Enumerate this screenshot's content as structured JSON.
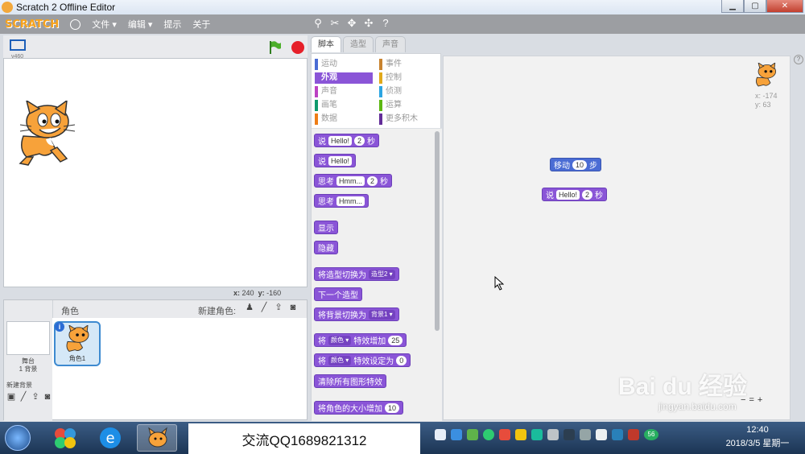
{
  "window": {
    "title": "Scratch 2 Offline Editor",
    "minimize": "▁",
    "maximize": "▢",
    "close": "✕"
  },
  "menubar": {
    "logo": "SCRATCH",
    "items": [
      "文件 ▾",
      "编辑 ▾",
      "提示",
      "关于"
    ],
    "tools": [
      "duplicate-icon",
      "delete-icon",
      "grow-icon",
      "shrink-icon",
      "help-icon"
    ]
  },
  "stage": {
    "version": "v460",
    "coord_x_label": "x:",
    "coord_x": "240",
    "coord_y_label": "y:",
    "coord_y": "-160"
  },
  "sprites": {
    "title": "角色",
    "new_sprite_label": "新建角色:",
    "stage_name": "舞台",
    "stage_backdrops": "1 背景",
    "new_backdrop": "新建背景",
    "sprite_name": "角色1",
    "info_badge": "i"
  },
  "tabs": [
    "脚本",
    "造型",
    "声音"
  ],
  "categories": [
    {
      "label": "运动",
      "color": "#4a6cd4"
    },
    {
      "label": "事件",
      "color": "#c88330"
    },
    {
      "label": "外观",
      "color": "#8a55d7"
    },
    {
      "label": "控制",
      "color": "#e1a91a"
    },
    {
      "label": "声音",
      "color": "#bb42c3"
    },
    {
      "label": "侦测",
      "color": "#2ca5e2"
    },
    {
      "label": "画笔",
      "color": "#0e9a6c"
    },
    {
      "label": "运算",
      "color": "#5cb712"
    },
    {
      "label": "数据",
      "color": "#ee7d16"
    },
    {
      "label": "更多积木",
      "color": "#632d99"
    }
  ],
  "palette_blocks": {
    "say_secs": {
      "say": "说",
      "text": "Hello!",
      "num": "2",
      "secs": "秒"
    },
    "say": {
      "say": "说",
      "text": "Hello!"
    },
    "think_secs": {
      "think": "思考",
      "text": "Hmm...",
      "num": "2",
      "secs": "秒"
    },
    "think": {
      "think": "思考",
      "text": "Hmm..."
    },
    "show": "显示",
    "hide": "隐藏",
    "switch_costume": {
      "label": "将造型切换为",
      "value": "造型2 ▾"
    },
    "next_costume": "下一个造型",
    "switch_backdrop": {
      "label": "将背景切换为",
      "value": "背景1 ▾"
    },
    "change_effect": {
      "prefix": "将",
      "effect": "颜色 ▾",
      "label": "特效增加",
      "num": "25"
    },
    "set_effect": {
      "prefix": "将",
      "effect": "颜色 ▾",
      "label": "特效设定为",
      "num": "0"
    },
    "clear_effects": "清除所有图形特效",
    "change_size": {
      "label": "将角色的大小增加",
      "num": "10"
    }
  },
  "script_blocks": {
    "move": {
      "label": "移动",
      "num": "10",
      "unit": "步"
    },
    "say_secs": {
      "say": "说",
      "text": "Hello!",
      "num": "2",
      "secs": "秒"
    }
  },
  "sprite_info": {
    "x_label": "x:",
    "x": "-174",
    "y_label": "y:",
    "y": "63"
  },
  "zoom": [
    "−",
    "=",
    "+"
  ],
  "watermark": {
    "brand": "Bai du 经验",
    "url": "jingyan.baidu.com"
  },
  "taskbar": {
    "banner": "交流QQ1689821312",
    "tray_badge": "56",
    "time": "12:40",
    "date": "2018/3/5 星期一"
  }
}
